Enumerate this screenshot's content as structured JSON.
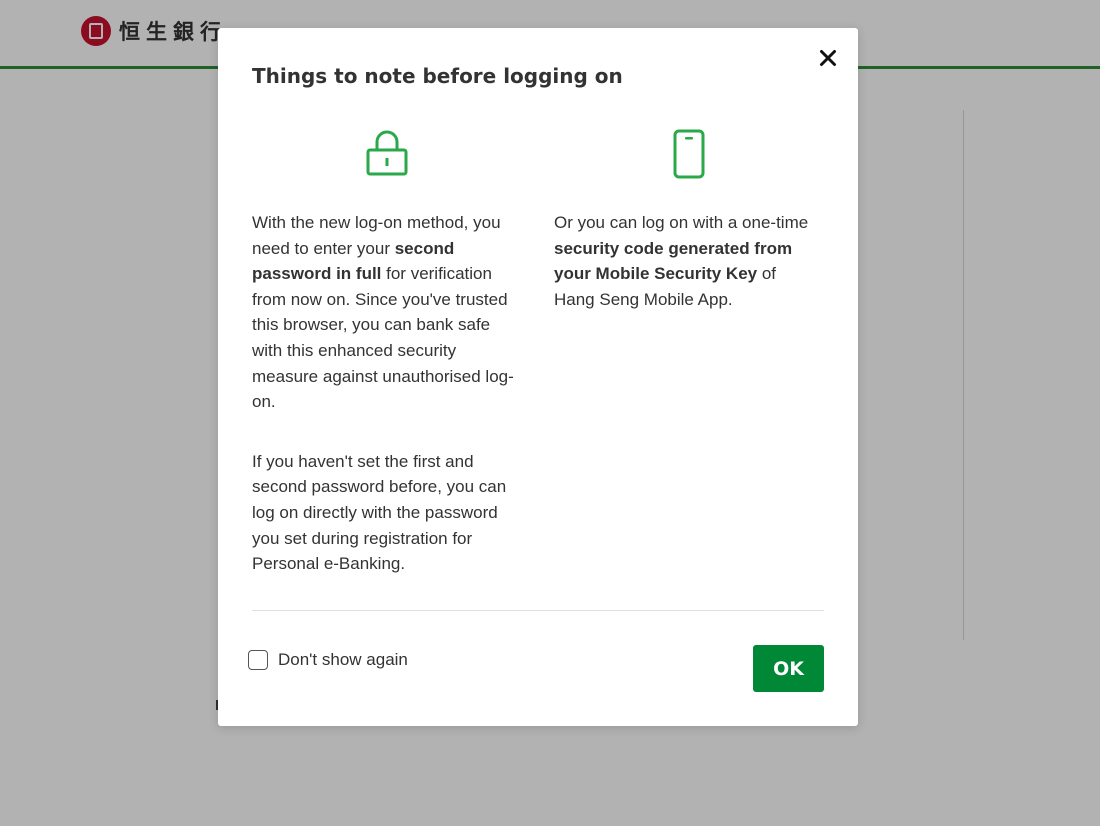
{
  "page": {
    "logo_text": "恒生銀行"
  },
  "modal": {
    "title": "Things to note before logging on",
    "close_label": "×",
    "left_column": {
      "icon": "lock-icon",
      "paragraph1": {
        "before_bold1": "With the new log-on method, you need to enter your ",
        "bold1": "second password in full",
        "after_bold1": " for verification from now on. Since you've trusted this browser, you can bank safe with this enhanced security measure against unauthorised log-on."
      },
      "paragraph2": "If you haven't set the first and second password before, you can log on directly with the password you set during registration for Personal e-Banking."
    },
    "right_column": {
      "icon": "mobile-phone-icon",
      "paragraph": {
        "before_bold": "Or you can log on with a one-time ",
        "bold": "security code generated from your Mobile Security Key",
        "after_bold": " of Hang Seng Mobile App."
      }
    },
    "checkbox": {
      "label": "Don't show again",
      "checked": false
    },
    "ok_label": "OK"
  },
  "colors": {
    "accent_green": "#008837",
    "icon_green": "#2aa84a",
    "header_rule": "#2e8b3a",
    "brand_red": "#c8102e",
    "text": "#333333"
  }
}
